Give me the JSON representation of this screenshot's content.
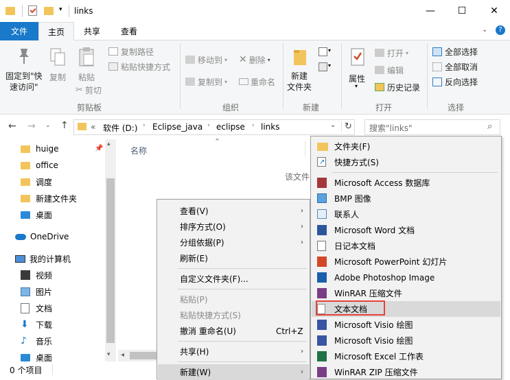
{
  "window": {
    "title": "links",
    "minimize": "—",
    "maximize": "☐",
    "close": "✕"
  },
  "tabs": {
    "file": "文件",
    "home": "主页",
    "share": "共享",
    "view": "查看"
  },
  "ribbon": {
    "pin": "固定到\"快\n速访问\"",
    "pin_l1": "固定到\"快",
    "pin_l2": "速访问\"",
    "copy": "复制",
    "paste": "粘贴",
    "copy_path": "复制路径",
    "paste_shortcut": "粘贴快捷方式",
    "cut": "剪切",
    "move_to": "移动到",
    "copy_to": "复制到",
    "delete": "删除",
    "rename": "重命名",
    "new_folder_l1": "新建",
    "new_folder_l2": "文件夹",
    "properties": "属性",
    "open": "打开",
    "edit": "编辑",
    "history": "历史记录",
    "select_all": "全部选择",
    "select_none": "全部取消",
    "invert": "反向选择",
    "groups": {
      "clipboard": "剪贴板",
      "organize": "组织",
      "new": "新建",
      "open": "打开",
      "select": "选择"
    }
  },
  "address": {
    "prefix": "«",
    "crumbs": [
      "软件 (D:)",
      "Eclipse_java",
      "eclipse",
      "links"
    ],
    "search_placeholder": "搜索\"links\""
  },
  "nav": {
    "items": [
      "huige",
      "office",
      "调度",
      "新建文件夹",
      "桌面",
      "OneDrive",
      "我的计算机",
      "视频",
      "图片",
      "文档",
      "下载",
      "音乐",
      "桌面"
    ]
  },
  "content": {
    "col_name": "名称",
    "partial_text": "该文件"
  },
  "status": {
    "count": "0 个项目"
  },
  "context_menu": {
    "items": [
      {
        "label": "查看(V)",
        "arrow": true
      },
      {
        "label": "排序方式(O)",
        "arrow": true
      },
      {
        "label": "分组依据(P)",
        "arrow": true
      },
      {
        "label": "刷新(E)"
      },
      {
        "label": "自定义文件夹(F)..."
      },
      {
        "label": "粘贴(P)",
        "disabled": true
      },
      {
        "label": "粘贴快捷方式(S)",
        "disabled": true
      },
      {
        "label": "撤消 重命名(U)",
        "shortcut": "Ctrl+Z"
      },
      {
        "label": "共享(H)",
        "arrow": true
      },
      {
        "label": "新建(W)",
        "arrow": true
      }
    ]
  },
  "submenu": {
    "items": [
      "文件夹(F)",
      "快捷方式(S)",
      "Microsoft Access 数据库",
      "BMP 图像",
      "联系人",
      "Microsoft Word 文档",
      "日记本文档",
      "Microsoft PowerPoint 幻灯片",
      "Adobe Photoshop Image",
      "WinRAR 压缩文件",
      "文本文档",
      "Microsoft Visio 绘图",
      "Microsoft Visio 绘图",
      "Microsoft Excel 工作表",
      "WinRAR ZIP 压缩文件"
    ]
  },
  "colors": {
    "accent": "#1979ca",
    "highlight": "#e5433a",
    "folder": "#f2c55c"
  }
}
